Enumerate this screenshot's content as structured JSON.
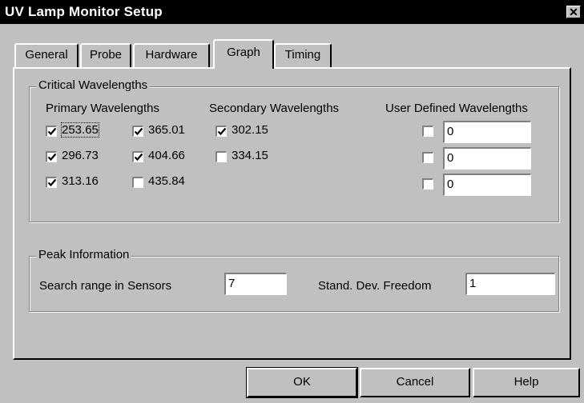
{
  "window": {
    "title": "UV Lamp Monitor Setup",
    "close_glyph": "✕"
  },
  "tabs": [
    {
      "label": "General",
      "active": false
    },
    {
      "label": "Probe",
      "active": false
    },
    {
      "label": "Hardware",
      "active": false
    },
    {
      "label": "Graph",
      "active": true
    },
    {
      "label": "Timing",
      "active": false
    }
  ],
  "critical": {
    "title": "Critical Wavelengths",
    "primary_title": "Primary Wavelengths",
    "secondary_title": "Secondary Wavelengths",
    "user_title": "User Defined Wavelengths",
    "primary": [
      {
        "label": "253.65",
        "checked": true
      },
      {
        "label": "365.01",
        "checked": true
      },
      {
        "label": "296.73",
        "checked": true
      },
      {
        "label": "404.66",
        "checked": true
      },
      {
        "label": "313.16",
        "checked": true
      },
      {
        "label": "435.84",
        "checked": false
      }
    ],
    "secondary": [
      {
        "label": "302.15",
        "checked": true
      },
      {
        "label": "334.15",
        "checked": false
      }
    ],
    "user": [
      {
        "value": "0",
        "checked": false
      },
      {
        "value": "0",
        "checked": false
      },
      {
        "value": "0",
        "checked": false
      }
    ]
  },
  "peak": {
    "title": "Peak Information",
    "search_label": "Search range in Sensors",
    "search_value": "7",
    "stddev_label": "Stand. Dev. Freedom",
    "stddev_value": "1"
  },
  "buttons": {
    "ok": "OK",
    "cancel": "Cancel",
    "help": "Help"
  }
}
